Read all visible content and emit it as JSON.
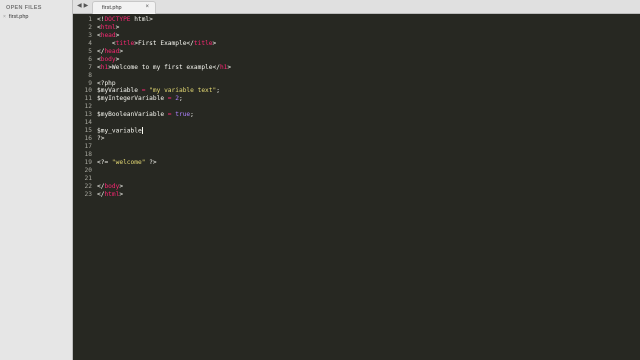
{
  "sidebar": {
    "header": "OPEN FILES",
    "files": [
      {
        "name": "first.php",
        "close": "×"
      }
    ]
  },
  "tabs": [
    {
      "label": "first.php",
      "close": "×"
    }
  ],
  "nav": {
    "back": "◀",
    "forward": "▶"
  },
  "editor": {
    "line_numbers": [
      "1",
      "2",
      "3",
      "4",
      "5",
      "6",
      "7",
      "8",
      "9",
      "10",
      "11",
      "12",
      "13",
      "14",
      "15",
      "16",
      "17",
      "18",
      "19",
      "20",
      "21",
      "22",
      "23"
    ],
    "lines": [
      {
        "tokens": [
          [
            "plain",
            "<!"
          ],
          [
            "tag",
            "DOCTYPE"
          ],
          [
            "plain",
            " html>"
          ]
        ]
      },
      {
        "tokens": [
          [
            "plain",
            "<"
          ],
          [
            "tag",
            "html"
          ],
          [
            "plain",
            ">"
          ]
        ]
      },
      {
        "tokens": [
          [
            "plain",
            "<"
          ],
          [
            "tag",
            "head"
          ],
          [
            "plain",
            ">"
          ]
        ]
      },
      {
        "tokens": [
          [
            "plain",
            "    <"
          ],
          [
            "tag",
            "title"
          ],
          [
            "plain",
            ">First Example</"
          ],
          [
            "tag",
            "title"
          ],
          [
            "plain",
            ">"
          ]
        ]
      },
      {
        "tokens": [
          [
            "plain",
            "</"
          ],
          [
            "tag",
            "head"
          ],
          [
            "plain",
            ">"
          ]
        ]
      },
      {
        "tokens": [
          [
            "plain",
            "<"
          ],
          [
            "tag",
            "body"
          ],
          [
            "plain",
            ">"
          ]
        ]
      },
      {
        "tokens": [
          [
            "plain",
            "<"
          ],
          [
            "tag",
            "h1"
          ],
          [
            "plain",
            ">Welcome to my first example</"
          ],
          [
            "tag",
            "h1"
          ],
          [
            "plain",
            ">"
          ]
        ]
      },
      {
        "tokens": []
      },
      {
        "tokens": [
          [
            "plain",
            "<?php"
          ]
        ]
      },
      {
        "tokens": [
          [
            "plain",
            "$myVariable "
          ],
          [
            "op",
            "="
          ],
          [
            "plain",
            " "
          ],
          [
            "str",
            "\"my variable text\""
          ],
          [
            "plain",
            ";"
          ]
        ]
      },
      {
        "tokens": [
          [
            "plain",
            "$myIntegerVariable "
          ],
          [
            "op",
            "="
          ],
          [
            "plain",
            " "
          ],
          [
            "num",
            "2"
          ],
          [
            "plain",
            ";"
          ]
        ]
      },
      {
        "tokens": []
      },
      {
        "tokens": [
          [
            "plain",
            "$myBooleanVariable "
          ],
          [
            "op",
            "="
          ],
          [
            "plain",
            " "
          ],
          [
            "const",
            "true"
          ],
          [
            "plain",
            ";"
          ]
        ]
      },
      {
        "tokens": []
      },
      {
        "tokens": [
          [
            "plain",
            "$my_variable"
          ]
        ],
        "cursor": true
      },
      {
        "tokens": [
          [
            "plain",
            "?>"
          ]
        ]
      },
      {
        "tokens": []
      },
      {
        "tokens": []
      },
      {
        "tokens": [
          [
            "plain",
            "<?= "
          ],
          [
            "str",
            "\"welcome\""
          ],
          [
            "plain",
            " ?>"
          ]
        ]
      },
      {
        "tokens": []
      },
      {
        "tokens": []
      },
      {
        "tokens": [
          [
            "plain",
            "</"
          ],
          [
            "tag",
            "body"
          ],
          [
            "plain",
            ">"
          ]
        ]
      },
      {
        "tokens": [
          [
            "plain",
            "</"
          ],
          [
            "tag",
            "html"
          ],
          [
            "plain",
            ">"
          ]
        ]
      }
    ]
  },
  "colors": {
    "background": "#272822",
    "tag": "#f92672",
    "string": "#e6db74",
    "number": "#ae81ff",
    "text": "#f8f8f2"
  }
}
